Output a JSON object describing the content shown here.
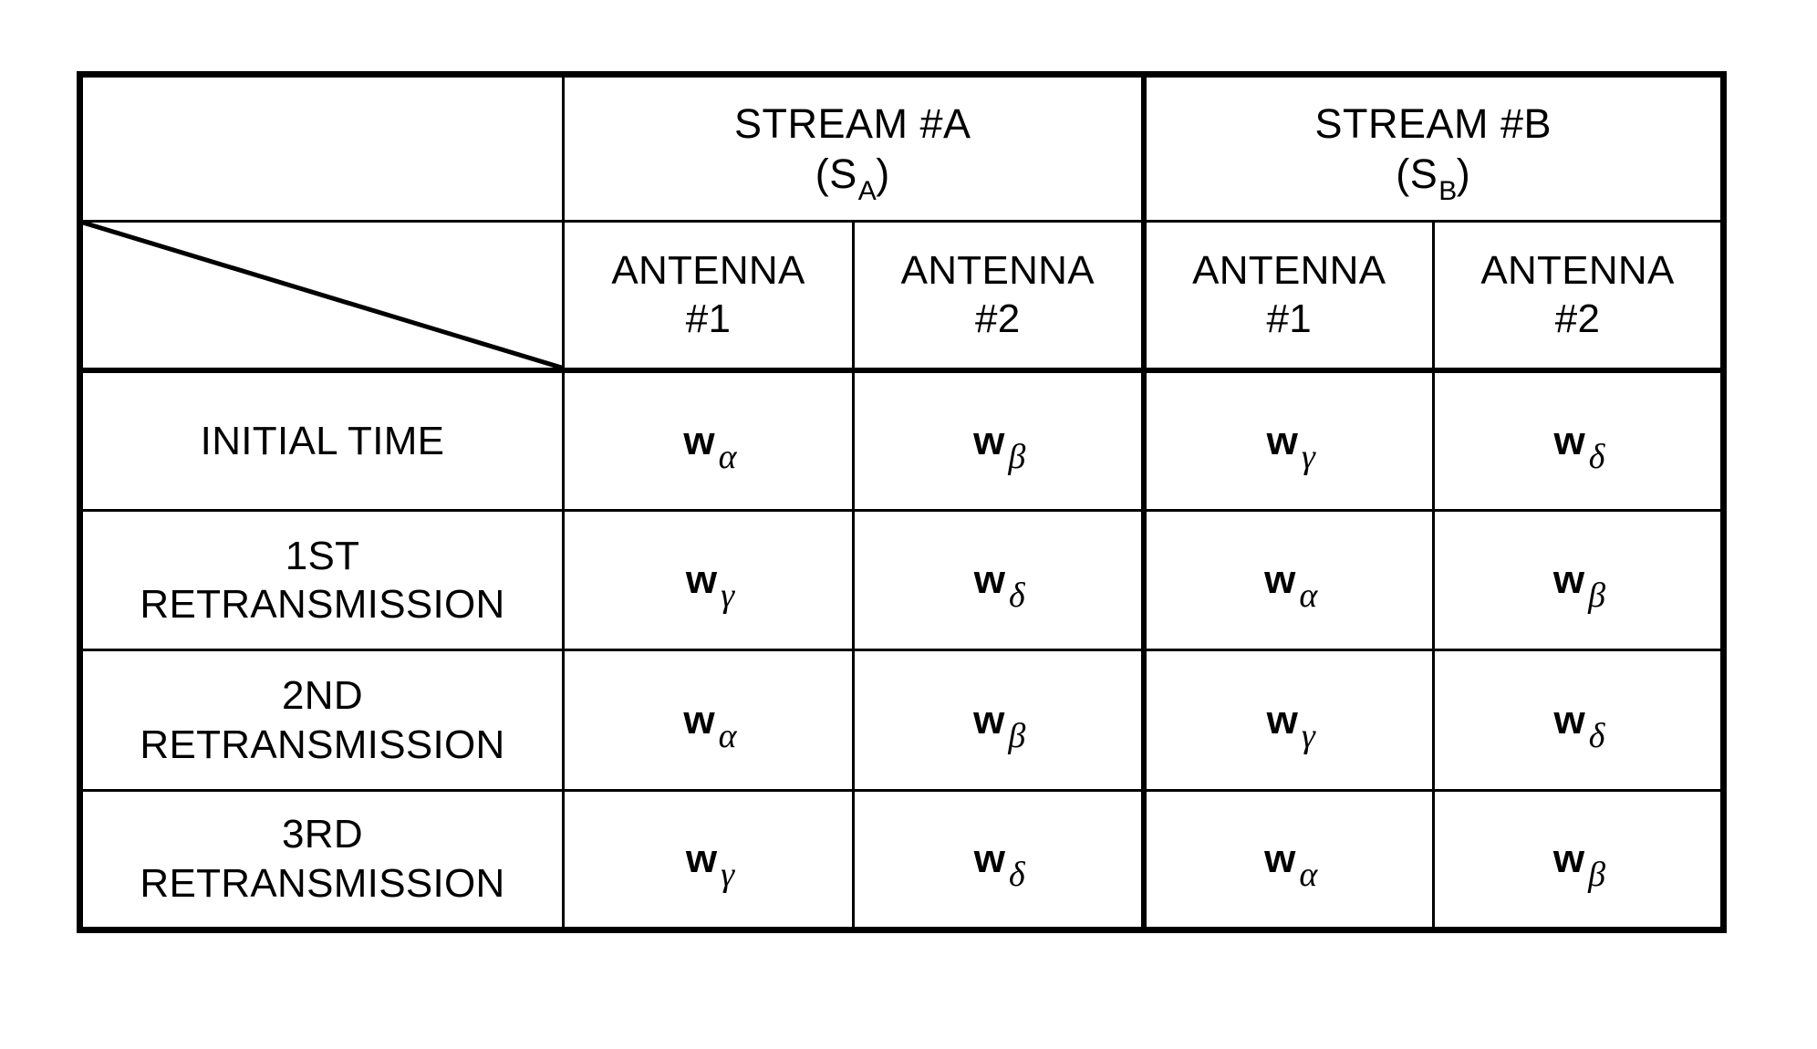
{
  "figure": {
    "type": "table",
    "caption": ""
  },
  "table": {
    "corner_cell": {
      "content": "",
      "decoration": "diagonal-slash"
    },
    "column_groups": [
      {
        "id": "stream-a",
        "title": "STREAM #A",
        "symbol_base": "S",
        "symbol_sub": "A",
        "symbol_open": "(",
        "symbol_close": ")",
        "columns": [
          {
            "name": "ANTENNA",
            "number": "#1"
          },
          {
            "name": "ANTENNA",
            "number": "#2"
          }
        ]
      },
      {
        "id": "stream-b",
        "title": "STREAM #B",
        "symbol_base": "S",
        "symbol_sub": "B",
        "symbol_open": "(",
        "symbol_close": ")",
        "columns": [
          {
            "name": "ANTENNA",
            "number": "#1"
          },
          {
            "name": "ANTENNA",
            "number": "#2"
          }
        ]
      }
    ],
    "rows": [
      {
        "id": "initial-time",
        "label_lines": [
          "INITIAL TIME"
        ],
        "cells": [
          {
            "base": "w",
            "sub": "α"
          },
          {
            "base": "w",
            "sub": "β"
          },
          {
            "base": "w",
            "sub": "γ"
          },
          {
            "base": "w",
            "sub": "δ"
          }
        ]
      },
      {
        "id": "retransmission-1",
        "label_lines": [
          "1ST",
          "RETRANSMISSION"
        ],
        "cells": [
          {
            "base": "w",
            "sub": "γ"
          },
          {
            "base": "w",
            "sub": "δ"
          },
          {
            "base": "w",
            "sub": "α"
          },
          {
            "base": "w",
            "sub": "β"
          }
        ]
      },
      {
        "id": "retransmission-2",
        "label_lines": [
          "2ND",
          "RETRANSMISSION"
        ],
        "cells": [
          {
            "base": "w",
            "sub": "α"
          },
          {
            "base": "w",
            "sub": "β"
          },
          {
            "base": "w",
            "sub": "γ"
          },
          {
            "base": "w",
            "sub": "δ"
          }
        ]
      },
      {
        "id": "retransmission-3",
        "label_lines": [
          "3RD",
          "RETRANSMISSION"
        ],
        "cells": [
          {
            "base": "w",
            "sub": "γ"
          },
          {
            "base": "w",
            "sub": "δ"
          },
          {
            "base": "w",
            "sub": "α"
          },
          {
            "base": "w",
            "sub": "β"
          }
        ]
      }
    ]
  },
  "colors": {
    "ink": "#000000",
    "paper": "#ffffff"
  }
}
